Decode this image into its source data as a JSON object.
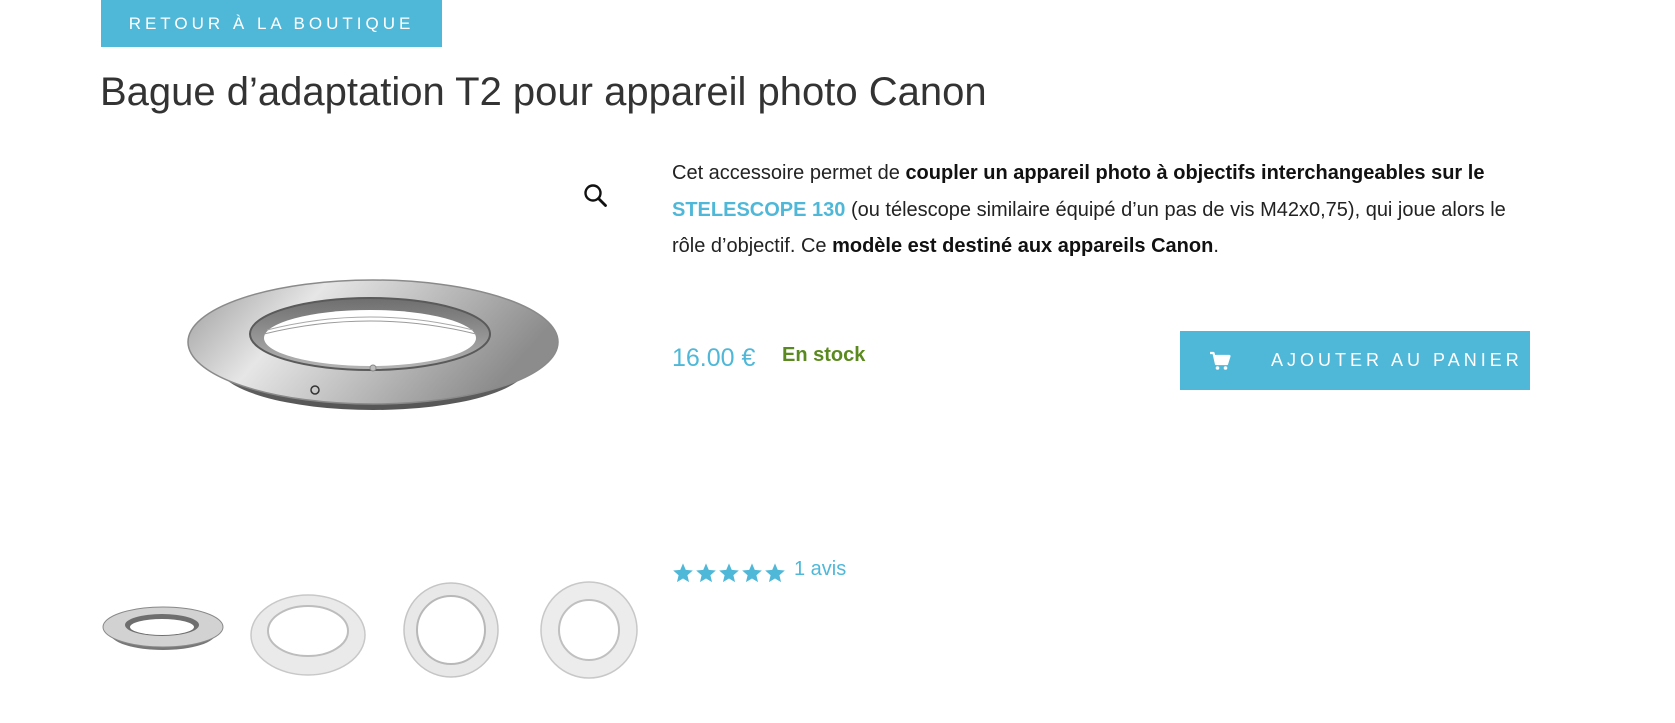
{
  "nav": {
    "back_label": "RETOUR À LA BOUTIQUE"
  },
  "product": {
    "title": "Bague d’adaptation T2 pour appareil photo Canon",
    "description": {
      "part1": "Cet accessoire permet de ",
      "bold1": "coupler un appareil photo à objectifs interchangeables sur le",
      "space1": " ",
      "link": "STELESCOPE 130",
      "part2": " (ou télescope similaire équipé d’un pas de vis M42x0,75), qui joue alors le rôle d’objectif. Ce ",
      "bold2": "modèle est destiné aux appareils Canon",
      "part3": "."
    },
    "price": "16.00 €",
    "stock": "En stock",
    "add_to_cart_label": "AJOUTER AU PANIER",
    "rating": {
      "stars": 5,
      "max": 5,
      "reviews_label": "1 avis"
    }
  },
  "icons": {
    "zoom": "magnifier-icon",
    "cart": "cart-icon",
    "star": "star-icon"
  },
  "colors": {
    "accent": "#4fb8d8",
    "stock": "#5a8a1f",
    "text": "#222222"
  }
}
